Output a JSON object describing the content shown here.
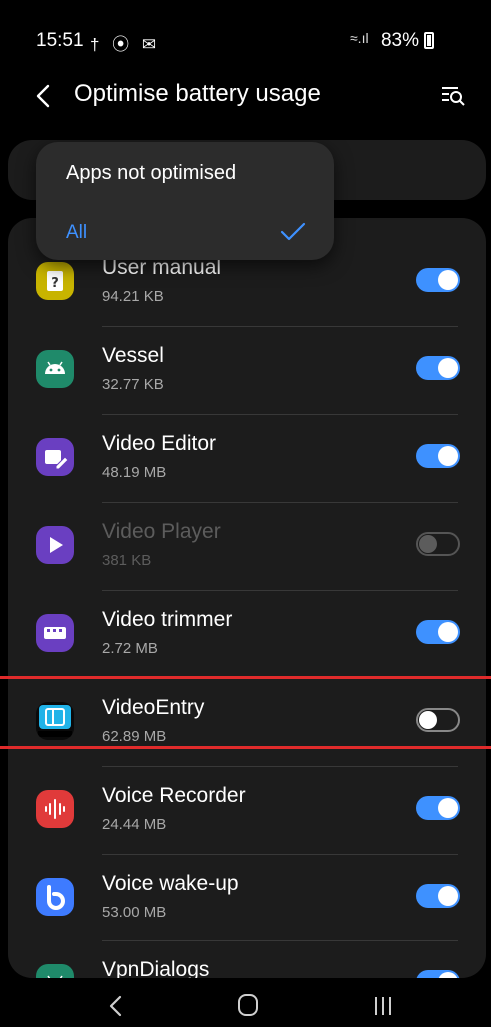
{
  "status_bar": {
    "time": "15:51",
    "left_icons": "† ⦿ ✉",
    "battery": "83%"
  },
  "header": {
    "title": "Optimise battery usage"
  },
  "dropdown": {
    "title": "Apps not optimised",
    "selected_option": "All"
  },
  "apps": [
    {
      "name": "User manual",
      "size": "94.21 KB",
      "state": "on",
      "icon": "user-manual-icon",
      "icon_bg": "#c8b400"
    },
    {
      "name": "Vessel",
      "size": "32.77 KB",
      "state": "on",
      "icon": "android-icon",
      "icon_bg": "#1f8a6a"
    },
    {
      "name": "Video Editor",
      "size": "48.19 MB",
      "state": "on",
      "icon": "video-editor-icon",
      "icon_bg": "#6a3fc1"
    },
    {
      "name": "Video Player",
      "size": "381 KB",
      "state": "disabled",
      "icon": "play-icon",
      "icon_bg": "#6a3fc1"
    },
    {
      "name": "Video trimmer",
      "size": "2.72 MB",
      "state": "on",
      "icon": "video-trimmer-icon",
      "icon_bg": "#6a3fc1"
    },
    {
      "name": "VideoEntry",
      "size": "62.89 MB",
      "state": "off",
      "icon": "videoentry-icon",
      "icon_bg": "#0a0a0a"
    },
    {
      "name": "Voice Recorder",
      "size": "24.44 MB",
      "state": "on",
      "icon": "voice-recorder-icon",
      "icon_bg": "#e03a3a"
    },
    {
      "name": "Voice wake-up",
      "size": "53.00 MB",
      "state": "on",
      "icon": "bixby-icon",
      "icon_bg": "#3e7bff"
    },
    {
      "name": "VpnDialogs",
      "size": "",
      "state": "on",
      "icon": "android-icon",
      "icon_bg": "#1f8a6a"
    }
  ],
  "colors": {
    "accent": "#3e91ff",
    "highlight": "#e02b2b",
    "card": "#1c1c1c"
  }
}
